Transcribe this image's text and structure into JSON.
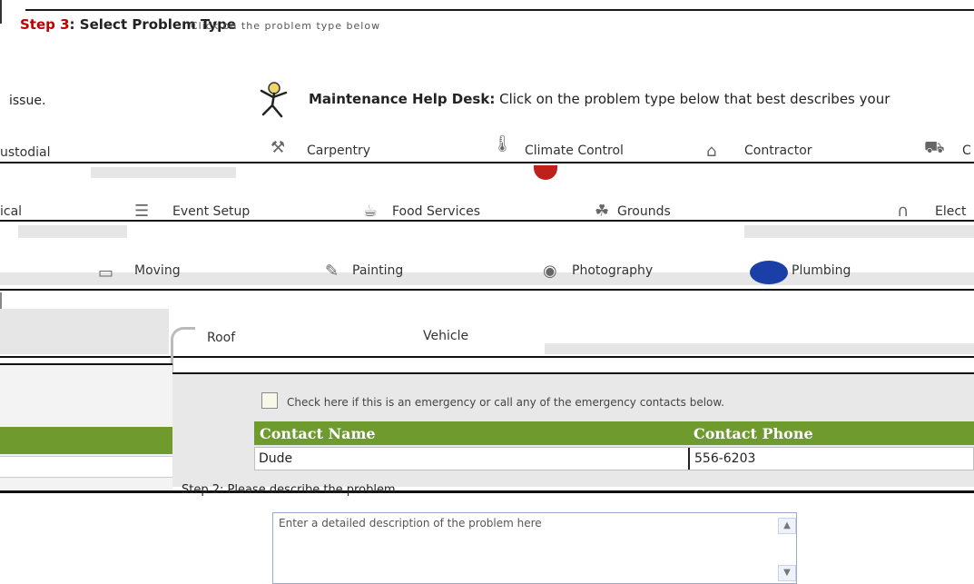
{
  "top": {
    "step_title_red": "Step 3",
    "step_title_rest": ": Select Problem Type",
    "subtitle": "Click on the problem type below"
  },
  "header": {
    "issue_text": "issue.",
    "helpdesk_title": "Maintenance Help Desk:",
    "helpdesk_desc": "Click on the problem type below that best describes your"
  },
  "categories": {
    "row1": [
      "ustodial",
      "Carpentry",
      "Climate Control",
      "Contractor",
      "C"
    ],
    "row2": [
      "ical",
      "Event Setup",
      "Food Services",
      "Grounds",
      "Elect"
    ],
    "row3": [
      "Moving",
      "Painting",
      "Photography",
      "Plumbing"
    ],
    "row4": [
      "Roof",
      "Vehicle"
    ]
  },
  "emergency": {
    "checkbox_label": "Check here if this is an emergency or call any of the emergency contacts below.",
    "checked": false
  },
  "contacts": {
    "headers": [
      "Contact Name",
      "Contact Phone"
    ],
    "rows": [
      {
        "name": "Dude",
        "phone": "556-6203"
      }
    ]
  },
  "step2": {
    "label": "Step 2: Please describe the problem"
  },
  "description": {
    "value": "Enter a detailed description of the problem here"
  },
  "colors": {
    "accent_green": "#6e9a2e",
    "step_red": "#c00000",
    "plumbing_badge": "#1a3fa6"
  }
}
